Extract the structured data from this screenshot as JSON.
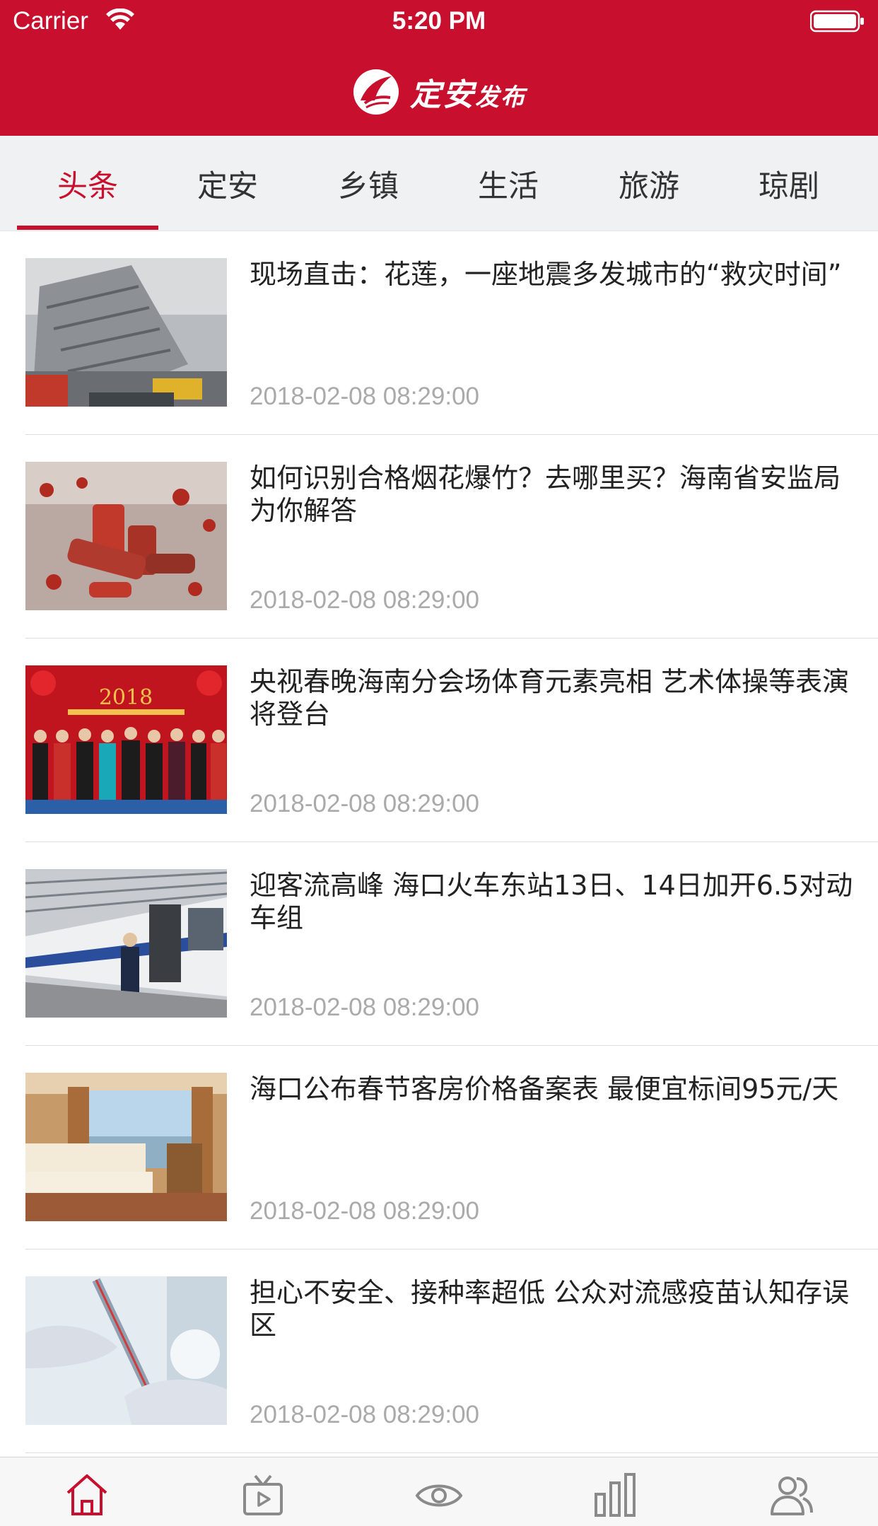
{
  "status_bar": {
    "carrier": "Carrier",
    "time": "5:20 PM"
  },
  "header": {
    "brand_main": "定安",
    "brand_sub": "发布",
    "color": "#c8102e"
  },
  "tabs": [
    {
      "label": "头条",
      "active": true
    },
    {
      "label": "定安",
      "active": false
    },
    {
      "label": "乡镇",
      "active": false
    },
    {
      "label": "生活",
      "active": false
    },
    {
      "label": "旅游",
      "active": false
    },
    {
      "label": "琼剧",
      "active": false
    }
  ],
  "news": [
    {
      "title": "现场直击：花莲，一座地震多发城市的“救灾时间”",
      "date": "2018-02-08 08:29:00",
      "thumb": "collapsed-building-photo"
    },
    {
      "title": "如何识别合格烟花爆竹？去哪里买？海南省安监局为你解答",
      "date": "2018-02-08 08:29:00",
      "thumb": "firecrackers-photo"
    },
    {
      "title": "央视春晚海南分会场体育元素亮相 艺术体操等表演将登台",
      "date": "2018-02-08 08:29:00",
      "thumb": "spring-gala-hosts-photo"
    },
    {
      "title": "迎客流高峰 海口火车东站13日、14日加开6.5对动车组",
      "date": "2018-02-08 08:29:00",
      "thumb": "high-speed-train-photo"
    },
    {
      "title": "海口公布春节客房价格备案表 最便宜标间95元/天",
      "date": "2018-02-08 08:29:00",
      "thumb": "hotel-room-photo"
    },
    {
      "title": "担心不安全、接种率超低 公众对流感疫苗认知存误区",
      "date": "2018-02-08 08:29:00",
      "thumb": "vaccine-syringe-photo"
    }
  ],
  "tabbar": [
    {
      "icon": "home-icon",
      "active": true
    },
    {
      "icon": "tv-icon",
      "active": false
    },
    {
      "icon": "eye-icon",
      "active": false
    },
    {
      "icon": "bar-chart-icon",
      "active": false
    },
    {
      "icon": "users-icon",
      "active": false
    }
  ],
  "colors": {
    "accent": "#c8102e",
    "inactive_icon": "#8a8a8a",
    "date_text": "#aaaaaa"
  }
}
